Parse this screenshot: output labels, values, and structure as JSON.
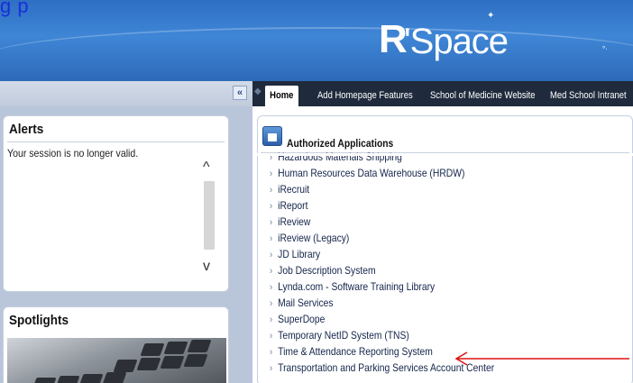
{
  "header": {
    "link_text": "g                  p        ",
    "logo_r": "R",
    "logo_space": "'Space"
  },
  "nav": {
    "collapse_glyph": "«",
    "back_glyph": "◆",
    "tabs": [
      {
        "label": "Home",
        "active": true
      },
      {
        "label": "Add Homepage Features",
        "active": false
      },
      {
        "label": "School of Medicine Website",
        "active": false
      },
      {
        "label": "Med School Intranet",
        "active": false
      }
    ]
  },
  "alerts": {
    "title": "Alerts",
    "message": "Your session is no longer valid.",
    "scroll_up": "^",
    "scroll_down": "v"
  },
  "spotlights": {
    "title": "Spotlights"
  },
  "applications": {
    "title": "Authorized Applications",
    "items": [
      "Hazardous Materials Shipping",
      "Human Resources Data Warehouse (HRDW)",
      "iRecruit",
      "iReport",
      "iReview",
      "iReview (Legacy)",
      "JD Library",
      "Job Description System",
      "Lynda.com - Software Training Library",
      "Mail Services",
      "SuperDope",
      "Temporary NetID System (TNS)",
      "Time & Attendance Reporting System",
      "Transportation and Parking Services Account Center"
    ]
  },
  "colors": {
    "header_blue": "#3f86d6",
    "tab_bar": "#1f2b3d",
    "annotation_arrow": "#e01010"
  },
  "icons": [
    "collapse-chevrons-icon",
    "app-folder-icon",
    "red-annotation-arrow-icon"
  ]
}
